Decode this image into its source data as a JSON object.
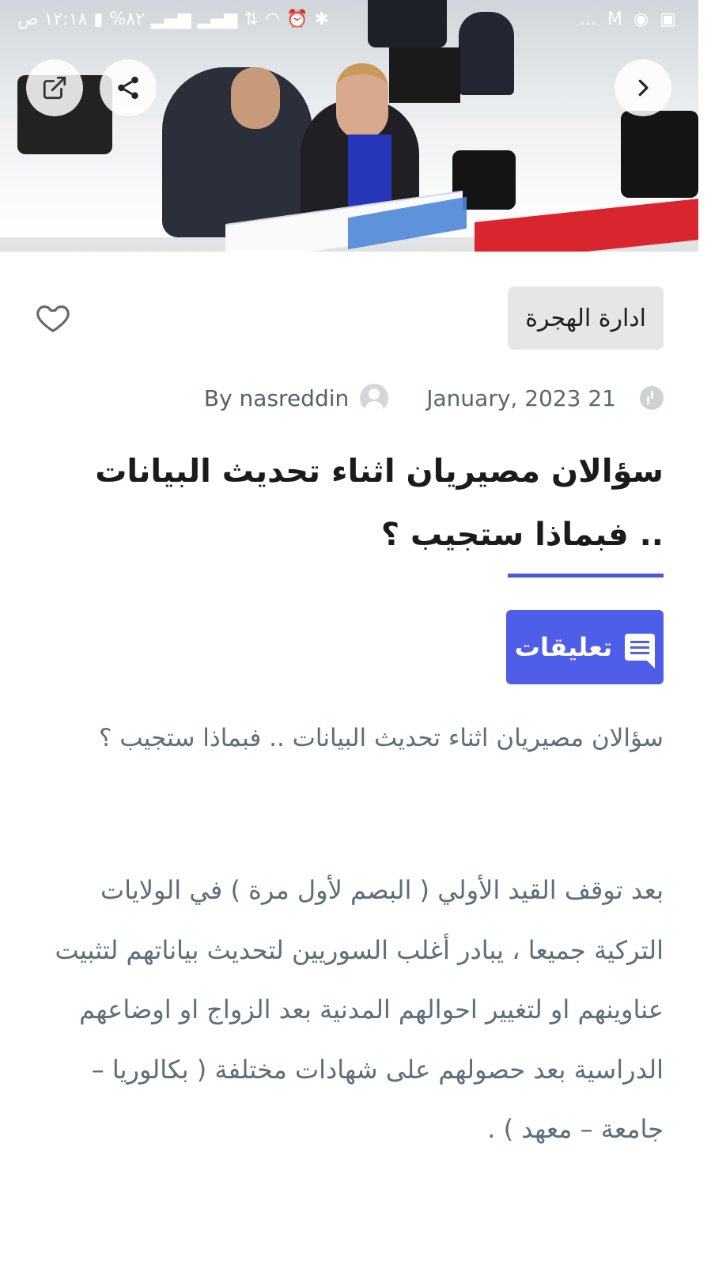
{
  "status_bar": {
    "time": "١٢:١٨ ص",
    "battery": "%٨٢",
    "overflow": "..."
  },
  "hero": {
    "image_description_icon": "office-photo"
  },
  "toolbar": {
    "open_external_icon": "external-link-icon",
    "share_icon": "share-icon",
    "next_icon": "chevron-right-icon"
  },
  "article": {
    "category": "ادارة الهجرة",
    "date": "January, 2023 21",
    "author": "By nasreddin",
    "title": "سؤالان مصيريان اثناء تحديث البيانات .. فبماذا ستجيب ؟",
    "comments_label": "تعليقات",
    "subtitle": "سؤالان مصيريان اثناء تحديث البيانات .. فبماذا ستجيب ؟",
    "body": "بعد توقف القيد الأولي ( البصم لأول مرة )  في الولايات التركية جميعا ، يبادر أغلب السوريين لتحديث بياناتهم لتثبيت عناوينهم او لتغيير احوالهم المدنية بعد الزواج او اوضاعهم الدراسية بعد حصولهم على شهادات مختلفة ( بكالوريا – جامعة – معهد ) ."
  },
  "colors": {
    "accent": "#4f5ee8",
    "underline": "#4d5ad8",
    "category_bg": "#e6e6e6",
    "body_text": "#5c6e78"
  }
}
